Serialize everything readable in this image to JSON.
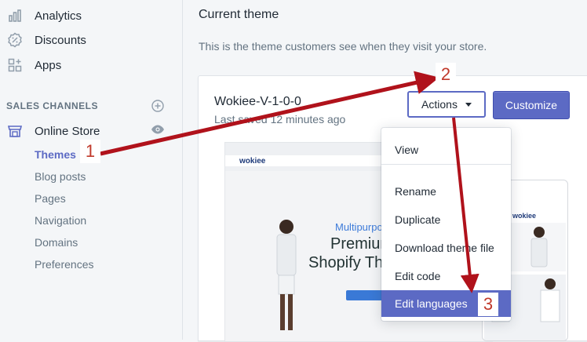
{
  "sidebar": {
    "items": [
      {
        "label": "Analytics",
        "icon": "bar-chart-icon"
      },
      {
        "label": "Discounts",
        "icon": "discount-icon"
      },
      {
        "label": "Apps",
        "icon": "apps-icon"
      }
    ],
    "sales_channels_title": "SALES CHANNELS",
    "online_store_label": "Online Store",
    "sub_items": [
      "Themes",
      "Blog posts",
      "Pages",
      "Navigation",
      "Domains",
      "Preferences"
    ]
  },
  "main": {
    "heading": "Current theme",
    "description": "This is the theme customers see when they visit your store.",
    "theme_name": "Wokiee-V-1-0-0",
    "theme_saved": "Last saved 12 minutes ago",
    "actions_label": "Actions",
    "customize_label": "Customize"
  },
  "preview": {
    "logo": "wokiee",
    "hero_line1": "Multipurpo",
    "hero_line2": "Premium",
    "hero_line3": "Shopify The",
    "mobile_logo": "wokiee"
  },
  "dropdown": {
    "items": [
      "View",
      "Rename",
      "Duplicate",
      "Download theme file",
      "Edit code",
      "Edit languages"
    ]
  },
  "annotations": {
    "n1": "1",
    "n2": "2",
    "n3": "3",
    "arrow_color": "#b0121b"
  },
  "colors": {
    "accent": "#5c6ac4"
  }
}
